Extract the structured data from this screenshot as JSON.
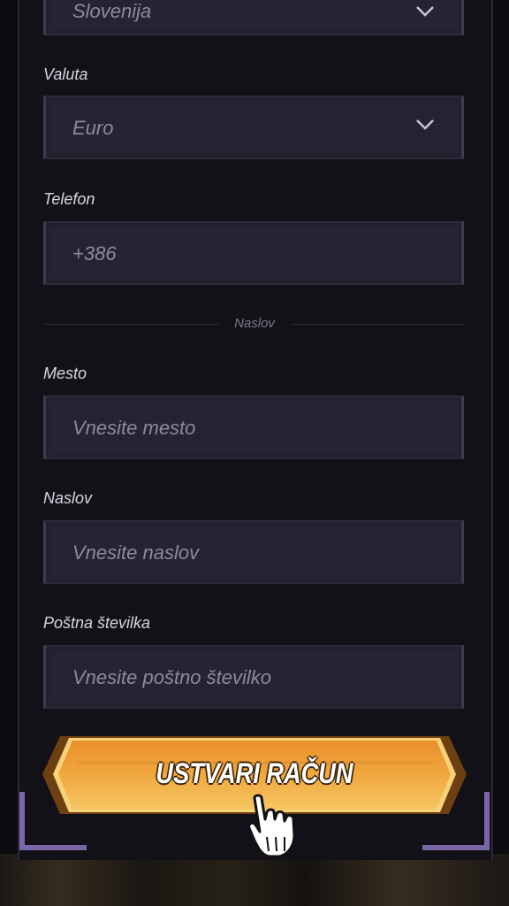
{
  "form": {
    "country_value": "Slovenija",
    "currency": {
      "label": "Valuta",
      "value": "Euro"
    },
    "phone": {
      "label": "Telefon",
      "placeholder": "+386"
    },
    "section_title": "Naslov",
    "city": {
      "label": "Mesto",
      "placeholder": "Vnesite mesto"
    },
    "address": {
      "label": "Naslov",
      "placeholder": "Vnesite naslov"
    },
    "postal": {
      "label": "Poštna številka",
      "placeholder": "Vnesite poštno številko"
    },
    "submit_label": "USTVARI RAČUN"
  },
  "colors": {
    "accent_orange": "#f1a33a",
    "corner_purple": "#7b67a8"
  },
  "icons": {
    "dropdown": "chevron-down-icon",
    "cursor": "hand-pointer-icon"
  }
}
